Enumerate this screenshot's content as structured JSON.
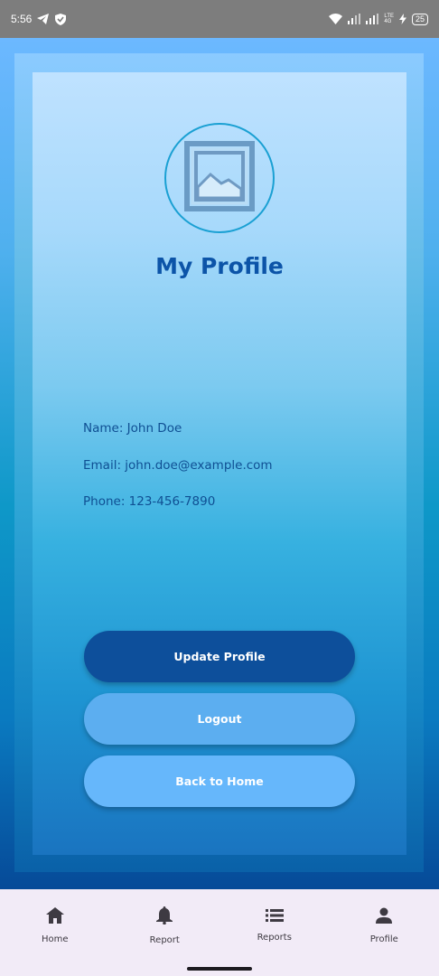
{
  "status_bar": {
    "time": "5:56",
    "network_label_top": "LTE",
    "network_label_bottom": "4G",
    "battery": "25"
  },
  "profile": {
    "title": "My Profile",
    "avatar_icon": "image-placeholder-icon",
    "name_line": "Name: John Doe",
    "email_line": "Email: john.doe@example.com",
    "phone_line": "Phone: 123-456-7890"
  },
  "actions": {
    "update_label": "Update Profile",
    "logout_label": "Logout",
    "back_label": "Back to Home"
  },
  "nav": {
    "items": [
      {
        "label": "Home",
        "icon": "home-icon"
      },
      {
        "label": "Report",
        "icon": "bell-icon"
      },
      {
        "label": "Reports",
        "icon": "list-icon"
      },
      {
        "label": "Profile",
        "icon": "person-icon"
      }
    ]
  },
  "colors": {
    "primary_dark": "#0d4f9b",
    "logout_button": "#5caef0",
    "home_button": "#66b7fb",
    "title_text": "#0c54a8",
    "nav_background": "#f2ebf7"
  }
}
